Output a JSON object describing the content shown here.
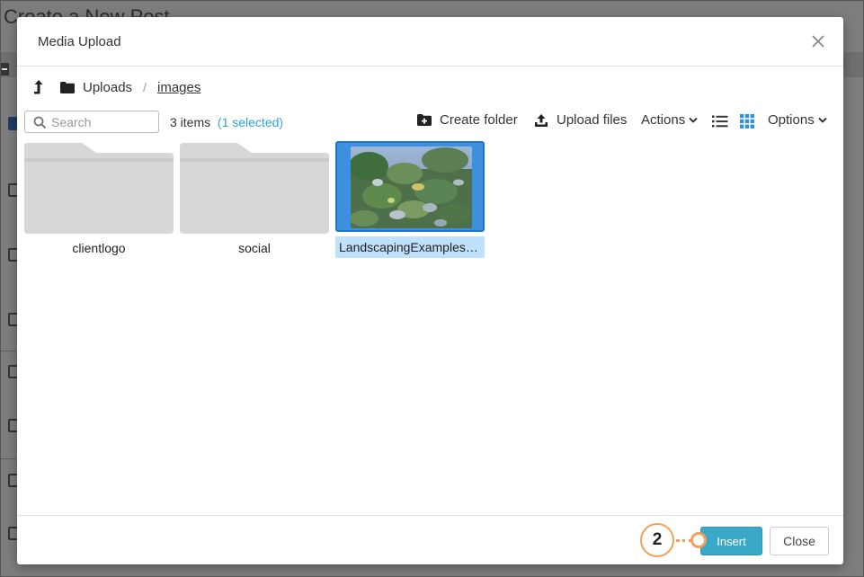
{
  "background": {
    "page_title": "Create a New Post"
  },
  "dialog": {
    "title": "Media Upload",
    "close_icon": "close-icon"
  },
  "breadcrumb": {
    "up_icon": "up-arrow-icon",
    "folder_icon": "folder-icon",
    "root": "Uploads",
    "separator": "/",
    "current": "images"
  },
  "toolbar": {
    "search_placeholder": "Search",
    "search_value": "",
    "item_count": "3 items",
    "paren_open": "(",
    "selected_text": "1 selected",
    "paren_close": ")",
    "create_folder": "Create folder",
    "upload_files": "Upload files",
    "actions": "Actions",
    "options": "Options",
    "active_view": "grid"
  },
  "items": [
    {
      "name": "clientlogo",
      "type": "folder",
      "selected": false
    },
    {
      "name": "social",
      "type": "folder",
      "selected": false
    },
    {
      "name": "LandscapingExamples…",
      "type": "image",
      "selected": true
    }
  ],
  "footer": {
    "insert": "Insert",
    "close": "Close"
  },
  "callout": {
    "number": "2"
  },
  "colors": {
    "accent": "#3aa9c8",
    "selection": "#3d8fe0",
    "selected_label_bg": "#bfe1fb",
    "callout": "#f3a05a",
    "folder": "#d7d7d7"
  }
}
